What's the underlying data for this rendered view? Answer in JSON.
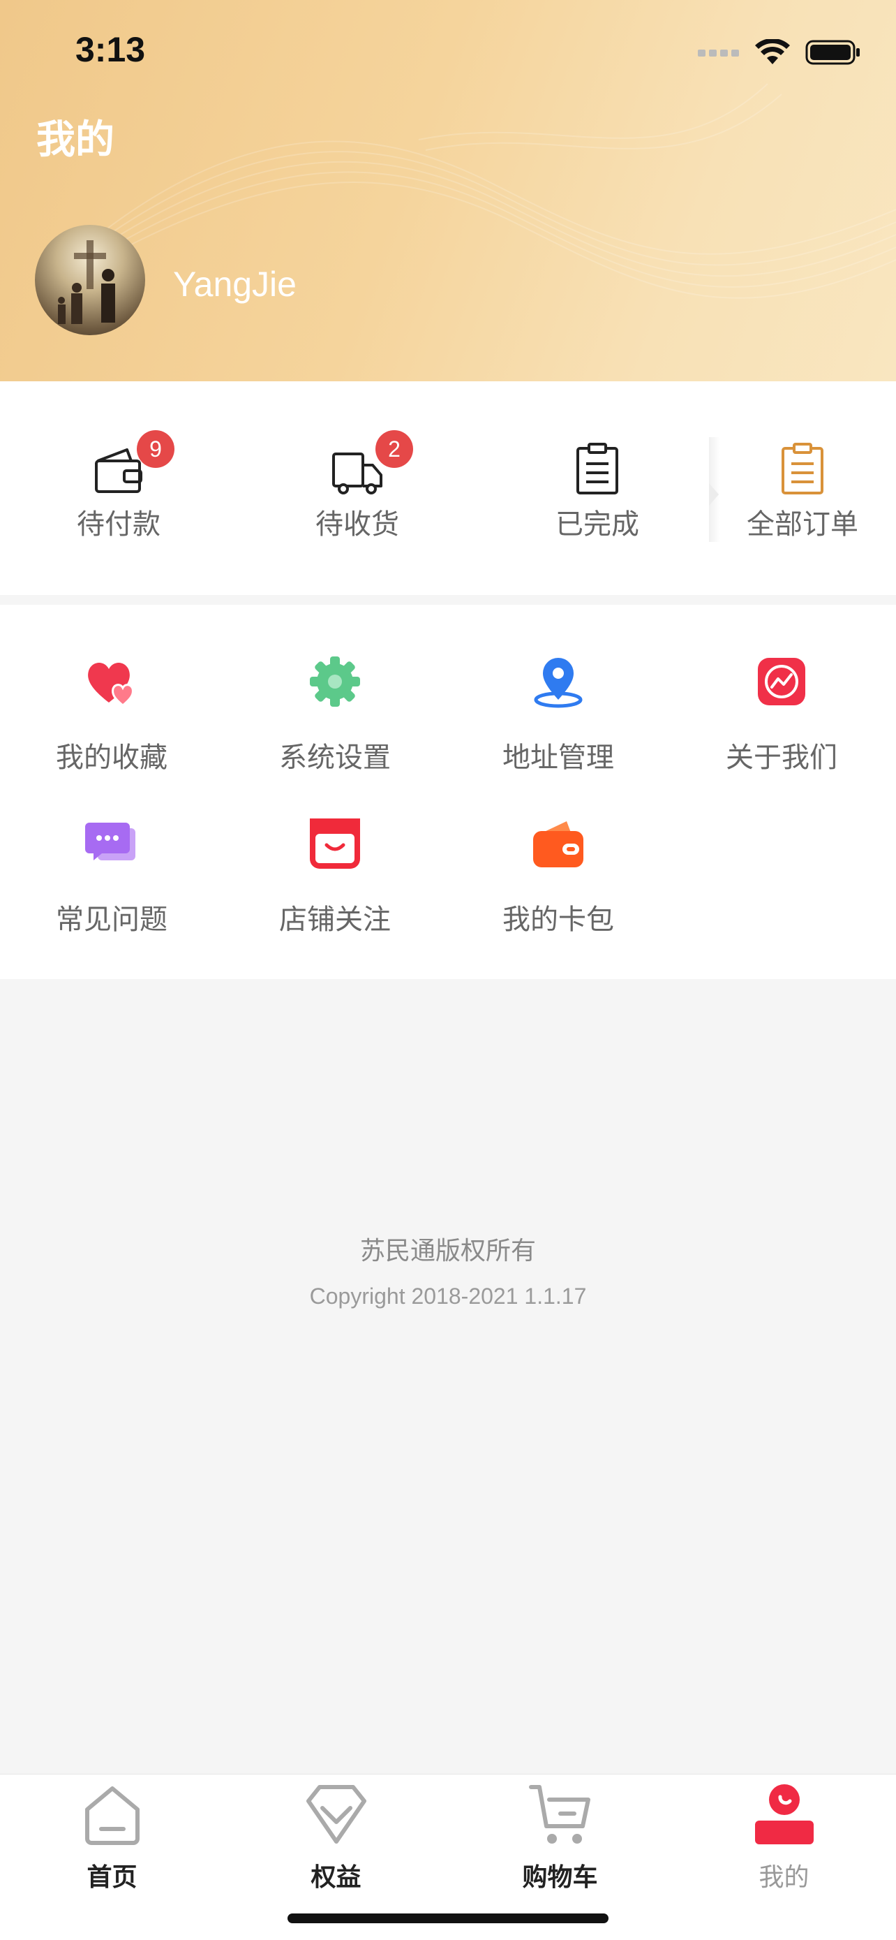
{
  "status": {
    "time": "3:13"
  },
  "header": {
    "title": "我的",
    "username": "YangJie"
  },
  "orders": {
    "items": [
      {
        "label": "待付款",
        "badge": "9",
        "icon": "wallet-icon"
      },
      {
        "label": "待收货",
        "badge": "2",
        "icon": "truck-icon"
      },
      {
        "label": "已完成",
        "badge": "",
        "icon": "clipboard-icon"
      }
    ],
    "all_label": "全部订单"
  },
  "menu": [
    {
      "label": "我的收藏",
      "icon": "heart-icon",
      "color": "#f0384e"
    },
    {
      "label": "系统设置",
      "icon": "gear-icon",
      "color": "#5cc98a"
    },
    {
      "label": "地址管理",
      "icon": "location-pin-icon",
      "color": "#2f7bf0"
    },
    {
      "label": "关于我们",
      "icon": "trend-icon",
      "color": "#f03048"
    },
    {
      "label": "常见问题",
      "icon": "chat-icon",
      "color": "#a76bf2"
    },
    {
      "label": "店铺关注",
      "icon": "shop-icon",
      "color": "#f02a3a"
    },
    {
      "label": "我的卡包",
      "icon": "wallet-card-icon",
      "color": "#ff5a1f"
    }
  ],
  "footer": {
    "company": "苏民通版权所有",
    "copyright": "Copyright 2018-2021 1.1.17"
  },
  "tabbar": [
    {
      "label": "首页",
      "icon": "home-icon"
    },
    {
      "label": "权益",
      "icon": "diamond-icon"
    },
    {
      "label": "购物车",
      "icon": "cart-icon"
    },
    {
      "label": "我的",
      "icon": "profile-icon"
    }
  ],
  "colors": {
    "accent": "#f02a44",
    "header_start": "#f0c88a",
    "header_end": "#f9e6c0",
    "badge": "#e54848"
  }
}
